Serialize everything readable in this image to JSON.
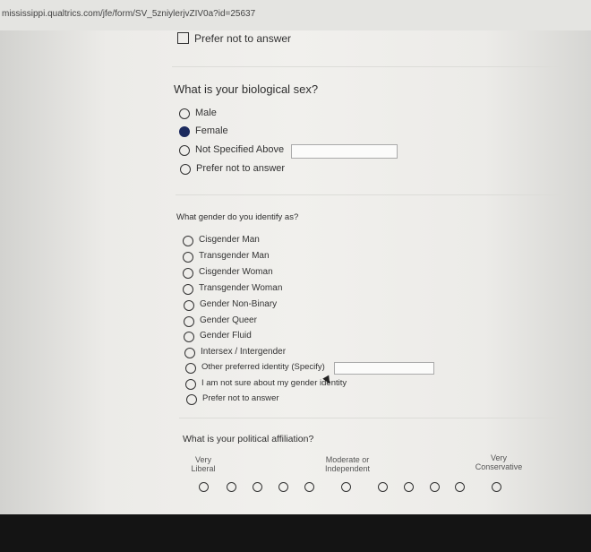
{
  "browser": {
    "url": "mississippi.qualtrics.com/jfe/form/SV_5zniylerjvZIV0a?id=25637"
  },
  "prev_question": {
    "option_label": "Prefer not to answer"
  },
  "q_sex": {
    "text": "What is your biological sex?",
    "options": [
      "Male",
      "Female",
      "Not Specified Above",
      "Prefer not to answer"
    ],
    "selected": "Female"
  },
  "q_gender": {
    "text": "What gender do you identify as?",
    "options": [
      "Cisgender Man",
      "Transgender Man",
      "Cisgender Woman",
      "Transgender Woman",
      "Gender Non-Binary",
      "Gender Queer",
      "Gender Fluid",
      "Intersex / Intergender",
      "Other preferred identity (Specify)",
      "I am not sure about my gender identity",
      "Prefer not to answer"
    ]
  },
  "q_political": {
    "text": "What is your political affiliation?",
    "left_label": "Very\nLiberal",
    "middle_label": "Moderate or\nIndependent",
    "right_label": "Very\nConservative"
  },
  "colors": {
    "selected_radio": "#1c2a5e",
    "bottom_bar": "#141414"
  }
}
